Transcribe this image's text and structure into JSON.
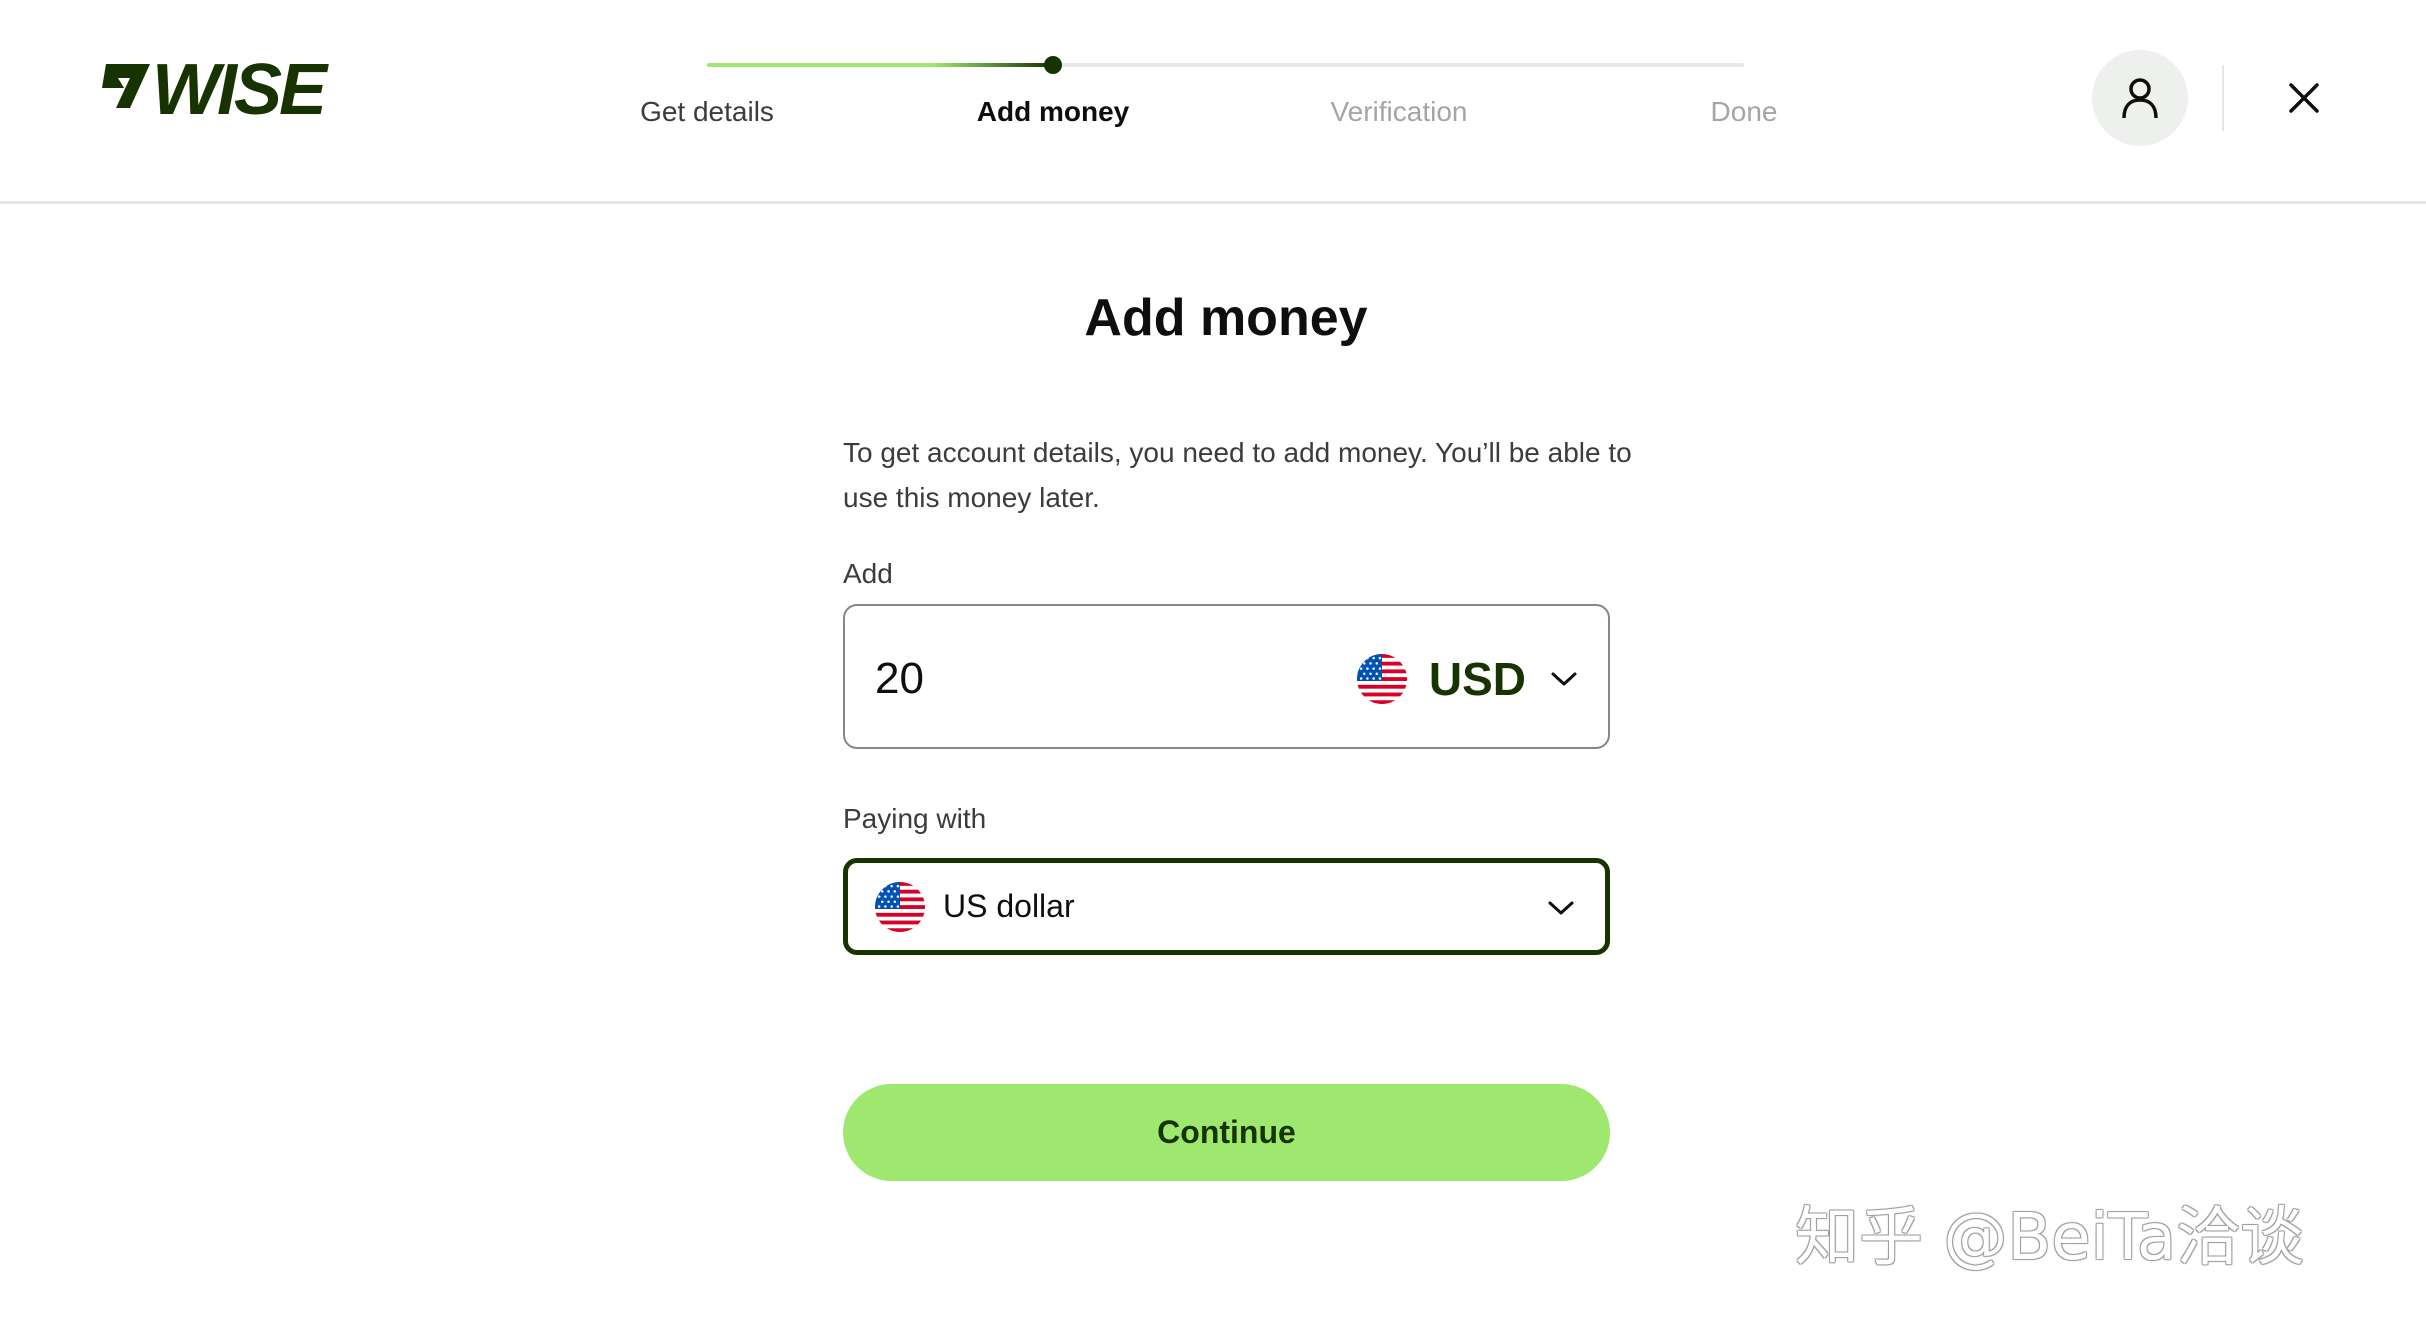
{
  "brand": {
    "logo_text": "WISE",
    "color_dark": "#163300",
    "color_accent": "#9fe870"
  },
  "stepper": {
    "progress": 0.33,
    "steps": [
      {
        "label": "Get details",
        "state": "done"
      },
      {
        "label": "Add money",
        "state": "active"
      },
      {
        "label": "Verification",
        "state": "todo"
      },
      {
        "label": "Done",
        "state": "todo"
      }
    ]
  },
  "header": {
    "profile_icon": "user-icon",
    "close_icon": "close-icon"
  },
  "main": {
    "title": "Add money",
    "intro": "To get account details, you need to add money. You’ll be able to use this money later.",
    "amount": {
      "label": "Add",
      "value": "20",
      "currency_code": "USD",
      "currency_flag": "us-flag-icon"
    },
    "paying_with": {
      "label": "Paying with",
      "value": "US dollar",
      "flag": "us-flag-icon"
    },
    "continue_label": "Continue"
  },
  "watermark": "知乎 @BeiTa洽谈"
}
